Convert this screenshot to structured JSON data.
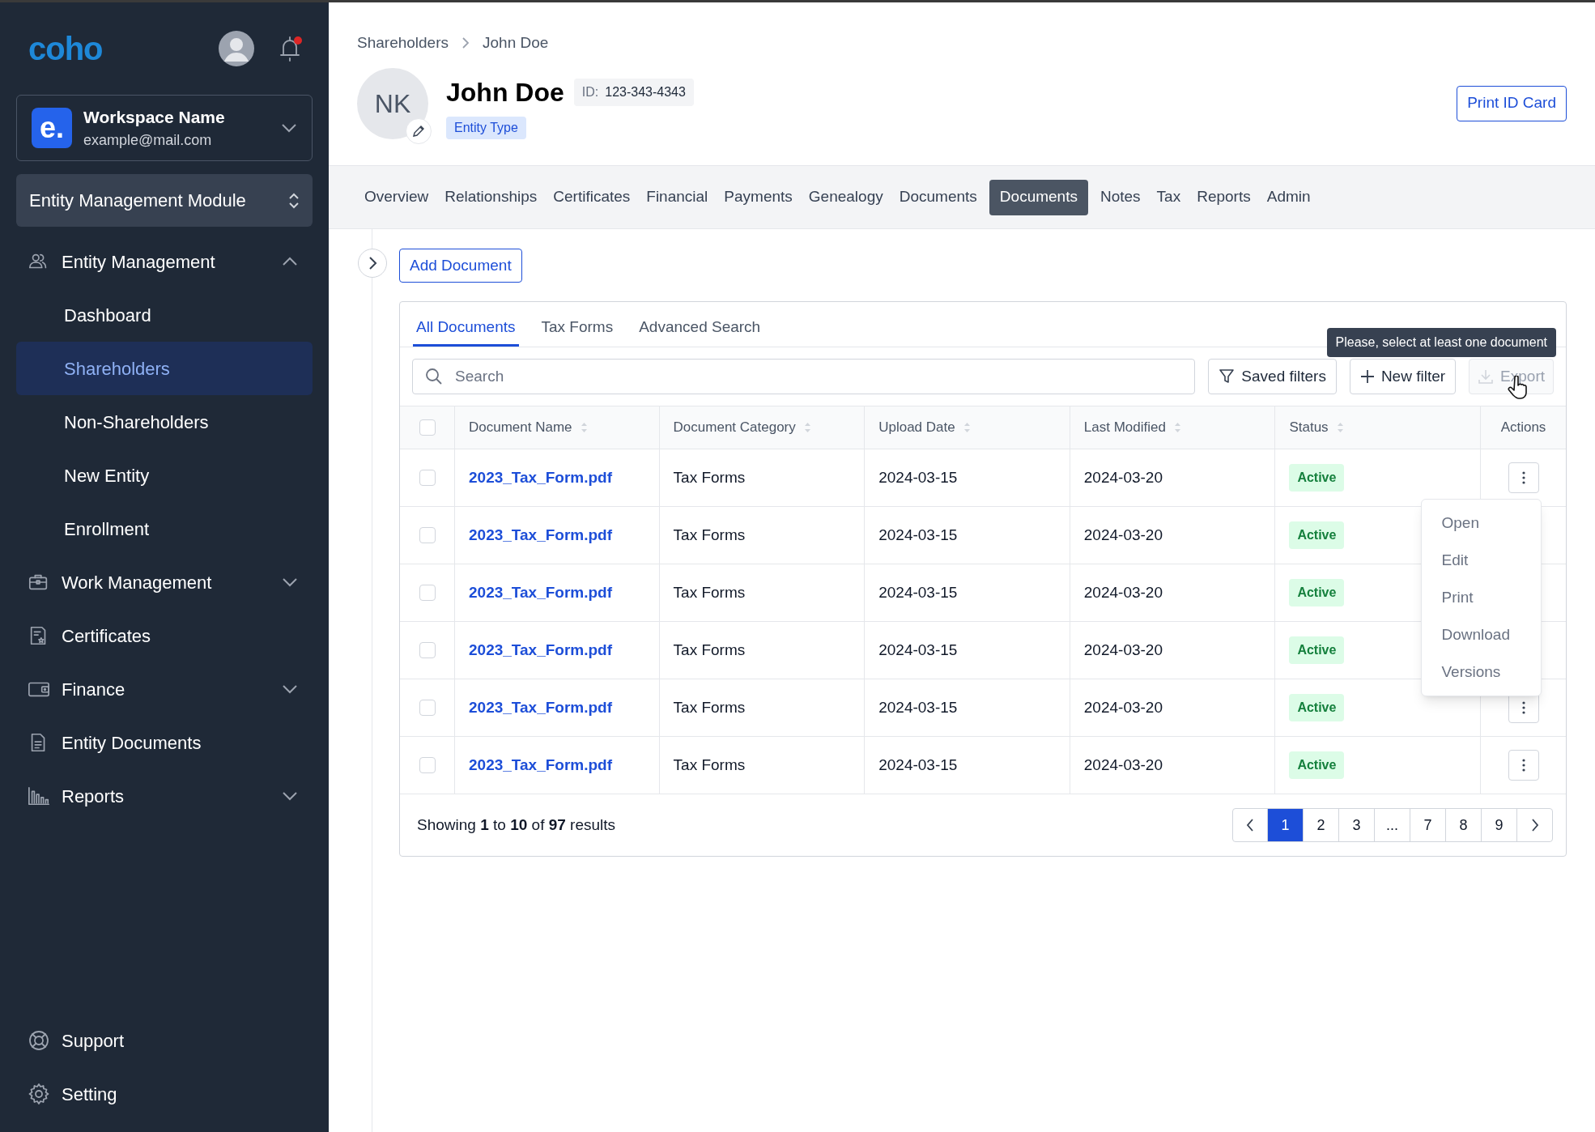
{
  "sidebar": {
    "logo": "coho",
    "notifications_unread": true,
    "workspace": {
      "initial": "e.",
      "name": "Workspace Name",
      "email": "example@mail.com"
    },
    "module": "Entity Management Module",
    "items": [
      {
        "label": "Entity Management",
        "expanded": true,
        "children": [
          {
            "label": "Dashboard",
            "selected": false
          },
          {
            "label": "Shareholders",
            "selected": true
          },
          {
            "label": "Non-Shareholders",
            "selected": false
          },
          {
            "label": "New Entity",
            "selected": false
          },
          {
            "label": "Enrollment",
            "selected": false
          }
        ]
      },
      {
        "label": "Work Management",
        "expanded": false
      },
      {
        "label": "Certificates"
      },
      {
        "label": "Finance",
        "expanded": false
      },
      {
        "label": "Entity Documents"
      },
      {
        "label": "Reports",
        "expanded": false
      }
    ],
    "footer_items": [
      {
        "label": "Support"
      },
      {
        "label": "Setting"
      }
    ]
  },
  "breadcrumb": [
    "Shareholders",
    "John Doe"
  ],
  "profile": {
    "initials": "NK",
    "name": "John Doe",
    "id_label": "ID:",
    "id_value": "123-343-4343",
    "entity_type": "Entity Type",
    "print_button": "Print ID Card"
  },
  "tabs": [
    {
      "label": "Overview",
      "selected": false
    },
    {
      "label": "Relationships",
      "selected": false
    },
    {
      "label": "Certificates",
      "selected": false
    },
    {
      "label": "Financial",
      "selected": false
    },
    {
      "label": "Payments",
      "selected": false
    },
    {
      "label": "Genealogy",
      "selected": false
    },
    {
      "label": "Documents",
      "selected": false
    },
    {
      "label": "Documents",
      "selected": true
    },
    {
      "label": "Notes",
      "selected": false
    },
    {
      "label": "Tax",
      "selected": false
    },
    {
      "label": "Reports",
      "selected": false
    },
    {
      "label": "Admin",
      "selected": false
    }
  ],
  "add_button": "Add Document",
  "doc_tabs": [
    {
      "label": "All Documents",
      "selected": true
    },
    {
      "label": "Tax Forms",
      "selected": false
    },
    {
      "label": "Advanced Search",
      "selected": false
    }
  ],
  "search": {
    "placeholder": "Search"
  },
  "toolbar": {
    "saved_filters": "Saved filters",
    "new_filter": "New filter",
    "export": {
      "label": "Export",
      "disabled": true
    },
    "tooltip": "Please, select at least one document"
  },
  "table": {
    "select_all": {
      "checked": false
    },
    "columns": [
      {
        "label": "Document Name",
        "sortable": true
      },
      {
        "label": "Document Category",
        "sortable": true
      },
      {
        "label": "Upload Date",
        "sortable": true
      },
      {
        "label": "Last Modified",
        "sortable": true
      },
      {
        "label": "Status",
        "sortable": true
      },
      {
        "label": "Actions",
        "sortable": false
      }
    ],
    "rows": [
      {
        "checked": false,
        "name": "2023_Tax_Form.pdf",
        "category": "Tax Forms",
        "uploaded": "2024-03-15",
        "modified": "2024-03-20",
        "status": "Active",
        "menu_button": true
      },
      {
        "checked": false,
        "name": "2023_Tax_Form.pdf",
        "category": "Tax Forms",
        "uploaded": "2024-03-15",
        "modified": "2024-03-20",
        "status": "Active",
        "menu_button": false
      },
      {
        "checked": false,
        "name": "2023_Tax_Form.pdf",
        "category": "Tax Forms",
        "uploaded": "2024-03-15",
        "modified": "2024-03-20",
        "status": "Active",
        "menu_button": false
      },
      {
        "checked": false,
        "name": "2023_Tax_Form.pdf",
        "category": "Tax Forms",
        "uploaded": "2024-03-15",
        "modified": "2024-03-20",
        "status": "Active",
        "menu_button": false
      },
      {
        "checked": false,
        "name": "2023_Tax_Form.pdf",
        "category": "Tax Forms",
        "uploaded": "2024-03-15",
        "modified": "2024-03-20",
        "status": "Active",
        "menu_button": true
      },
      {
        "checked": false,
        "name": "2023_Tax_Form.pdf",
        "category": "Tax Forms",
        "uploaded": "2024-03-15",
        "modified": "2024-03-20",
        "status": "Active",
        "menu_button": true
      }
    ],
    "row_menu": [
      "Open",
      "Edit",
      "Print",
      "Download",
      "Versions"
    ]
  },
  "footer": {
    "summary": "Showing **1** to **10** of **97** results",
    "pages": [
      {
        "label": "1",
        "selected": true
      },
      {
        "label": "2",
        "selected": false
      },
      {
        "label": "3",
        "selected": false
      },
      {
        "label": "...",
        "selected": false
      },
      {
        "label": "7",
        "selected": false
      },
      {
        "label": "8",
        "selected": false
      },
      {
        "label": "9",
        "selected": false
      }
    ]
  }
}
